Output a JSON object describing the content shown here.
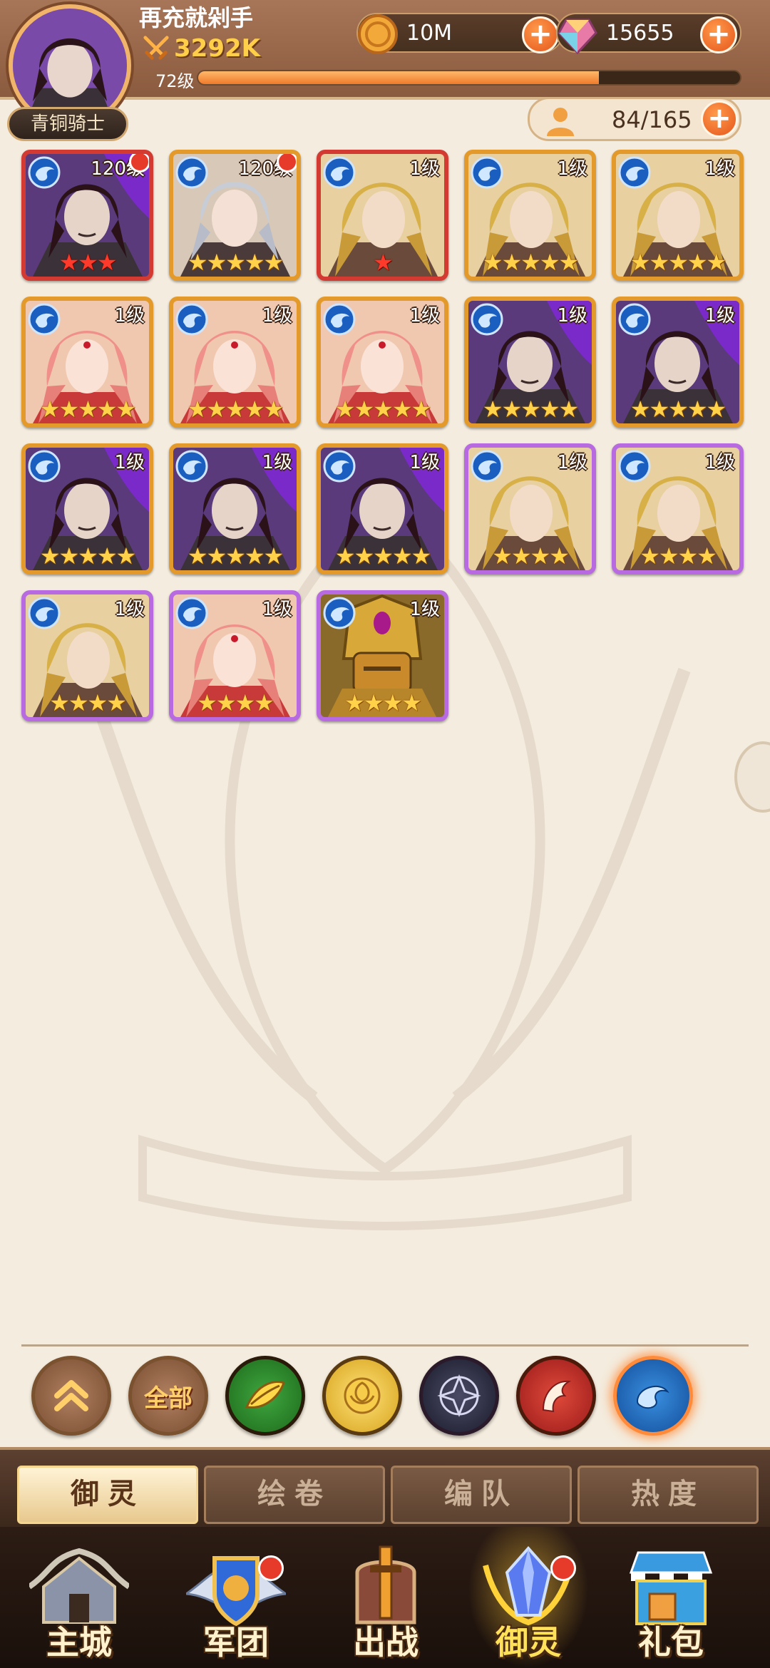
{
  "header": {
    "player_name": "再充就剁手",
    "power": "3292K",
    "rank_title": "青铜骑士",
    "level": "72级",
    "exp_fraction": 0.74,
    "coins": "10M",
    "gems": "15655",
    "hero_capacity": "84/165"
  },
  "heroes": [
    {
      "level": "120级",
      "stars": 3,
      "star_color": "red",
      "frame": "red",
      "portrait": "dark-hair-man",
      "red_dot": true
    },
    {
      "level": "120级",
      "stars": 5,
      "star_color": "gold",
      "frame": "orange",
      "portrait": "silver-hair-man",
      "red_dot": true
    },
    {
      "level": "1级",
      "stars": 1,
      "star_color": "red",
      "frame": "red",
      "portrait": "blonde-man",
      "red_dot": false
    },
    {
      "level": "1级",
      "stars": 5,
      "star_color": "gold",
      "frame": "orange",
      "portrait": "blonde-man",
      "red_dot": false
    },
    {
      "level": "1级",
      "stars": 5,
      "star_color": "gold",
      "frame": "orange",
      "portrait": "blonde-man",
      "red_dot": false
    },
    {
      "level": "1级",
      "stars": 5,
      "star_color": "gold",
      "frame": "orange",
      "portrait": "pink-hair-woman",
      "red_dot": false
    },
    {
      "level": "1级",
      "stars": 5,
      "star_color": "gold",
      "frame": "orange",
      "portrait": "pink-hair-woman",
      "red_dot": false
    },
    {
      "level": "1级",
      "stars": 5,
      "star_color": "gold",
      "frame": "orange",
      "portrait": "pink-hair-woman",
      "red_dot": false
    },
    {
      "level": "1级",
      "stars": 5,
      "star_color": "gold",
      "frame": "orange",
      "portrait": "dark-hair-man",
      "red_dot": false
    },
    {
      "level": "1级",
      "stars": 5,
      "star_color": "gold",
      "frame": "orange",
      "portrait": "dark-hair-man",
      "red_dot": false
    },
    {
      "level": "1级",
      "stars": 5,
      "star_color": "gold",
      "frame": "orange",
      "portrait": "dark-hair-man",
      "red_dot": false
    },
    {
      "level": "1级",
      "stars": 5,
      "star_color": "gold",
      "frame": "orange",
      "portrait": "dark-hair-man",
      "red_dot": false
    },
    {
      "level": "1级",
      "stars": 5,
      "star_color": "gold",
      "frame": "orange",
      "portrait": "dark-hair-man",
      "red_dot": false
    },
    {
      "level": "1级",
      "stars": 4,
      "star_color": "gold",
      "frame": "purple",
      "portrait": "blonde-man",
      "red_dot": false
    },
    {
      "level": "1级",
      "stars": 4,
      "star_color": "gold",
      "frame": "purple",
      "portrait": "blonde-man",
      "red_dot": false
    },
    {
      "level": "1级",
      "stars": 4,
      "star_color": "gold",
      "frame": "purple",
      "portrait": "blonde-man",
      "red_dot": false
    },
    {
      "level": "1级",
      "stars": 4,
      "star_color": "gold",
      "frame": "purple",
      "portrait": "pink-hair-woman",
      "red_dot": false
    },
    {
      "level": "1级",
      "stars": 4,
      "star_color": "gold",
      "frame": "purple",
      "portrait": "golden-warrior",
      "red_dot": false
    }
  ],
  "filters": [
    {
      "type": "collapse",
      "icon": "chevron-up-icon"
    },
    {
      "type": "all",
      "label": "全部"
    },
    {
      "type": "nature",
      "icon": "leaf-icon"
    },
    {
      "type": "holy",
      "icon": "rose-icon"
    },
    {
      "type": "dark",
      "icon": "star-sigil-icon"
    },
    {
      "type": "fire",
      "icon": "phoenix-icon"
    },
    {
      "type": "water",
      "icon": "water-icon",
      "selected": true
    }
  ],
  "tabs": [
    "御灵",
    "绘卷",
    "编队",
    "热度"
  ],
  "active_tab": 0,
  "nav": [
    {
      "label": "主城",
      "icon": "city-icon",
      "dot": false
    },
    {
      "label": "军团",
      "icon": "legion-icon",
      "dot": true
    },
    {
      "label": "出战",
      "icon": "battle-icon",
      "dot": false
    },
    {
      "label": "御灵",
      "icon": "crystal-icon",
      "dot": true,
      "active": true
    },
    {
      "label": "礼包",
      "icon": "gift-shop-icon",
      "dot": false
    }
  ],
  "colors": {
    "frame_red": "#d33a32",
    "frame_orange": "#e39a2a",
    "frame_purple": "#b86ae0",
    "accent_orange": "#f07a2a"
  }
}
